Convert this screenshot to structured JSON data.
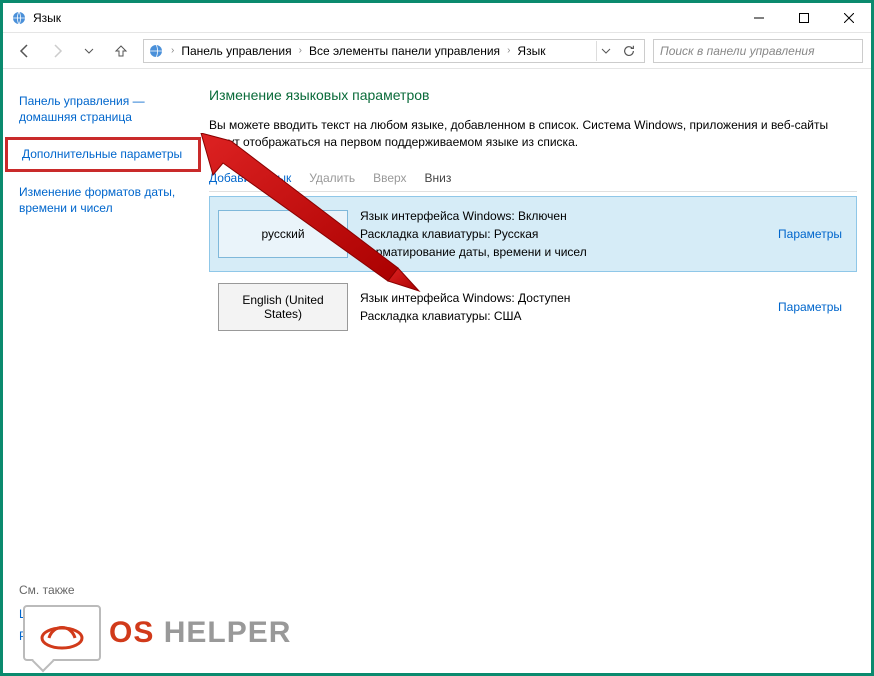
{
  "window": {
    "title": "Язык"
  },
  "breadcrumb": {
    "items": [
      "Панель управления",
      "Все элементы панели управления",
      "Язык"
    ]
  },
  "search": {
    "placeholder": "Поиск в панели управления"
  },
  "sidebar": {
    "home": "Панель управления — домашняя страница",
    "advanced": "Дополнительные параметры",
    "formats": "Изменение форматов даты, времени и чисел",
    "seealso_hdr": "См. также",
    "fonts": "Шрифты",
    "location": "Расположение"
  },
  "main": {
    "heading": "Изменение языковых параметров",
    "desc": "Вы можете вводить текст на любом языке, добавленном в список. Система Windows, приложения и веб-сайты будут отображаться на первом поддерживаемом языке из списка."
  },
  "toolbar": {
    "add": "Добавить язык",
    "remove": "Удалить",
    "up": "Вверх",
    "down": "Вниз"
  },
  "languages": [
    {
      "name": "русский",
      "line1": "Язык интерфейса Windows: Включен",
      "line2": "Раскладка клавиатуры: Русская",
      "line3": "Форматирование даты, времени и чисел",
      "options": "Параметры",
      "selected": true
    },
    {
      "name": "English (United States)",
      "line1": "Язык интерфейса Windows: Доступен",
      "line2": "Раскладка клавиатуры: США",
      "line3": "",
      "options": "Параметры",
      "selected": false
    }
  ],
  "watermark": {
    "os": "OS",
    "helper": " HELPER"
  }
}
